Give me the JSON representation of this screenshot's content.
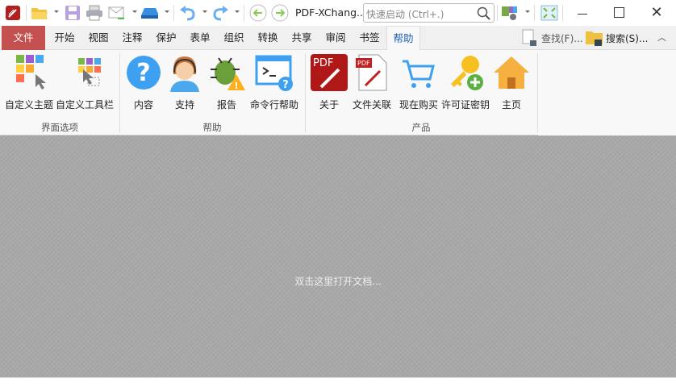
{
  "app": {
    "title": "PDF-XChang..",
    "search_placeholder": "快速启动 (Ctrl+.)"
  },
  "tabs": [
    {
      "label": "文件"
    },
    {
      "label": "开始"
    },
    {
      "label": "视图"
    },
    {
      "label": "注释"
    },
    {
      "label": "保护"
    },
    {
      "label": "表单"
    },
    {
      "label": "组织"
    },
    {
      "label": "转换"
    },
    {
      "label": "共享"
    },
    {
      "label": "审阅"
    },
    {
      "label": "书签"
    },
    {
      "label": "帮助"
    }
  ],
  "tabright": {
    "find": "查找(F)...",
    "search": "搜索(S)..."
  },
  "ribbon": {
    "groups": [
      {
        "label": "界面选项",
        "items": [
          {
            "label": "自定义主题"
          },
          {
            "label": "自定义工具栏"
          }
        ]
      },
      {
        "label": "帮助",
        "items": [
          {
            "label": "内容"
          },
          {
            "label": "支持"
          },
          {
            "label": "报告"
          },
          {
            "label": "命令行帮助"
          }
        ]
      },
      {
        "label": "产品",
        "items": [
          {
            "label": "关于"
          },
          {
            "label": "文件关联"
          },
          {
            "label": "现在购买"
          },
          {
            "label": "许可证密钥"
          },
          {
            "label": "主页"
          }
        ]
      }
    ]
  },
  "workspace": {
    "hint": "双击这里打开文档..."
  },
  "colors": {
    "file_tab": "#c55050",
    "accent": "#2060b0"
  }
}
